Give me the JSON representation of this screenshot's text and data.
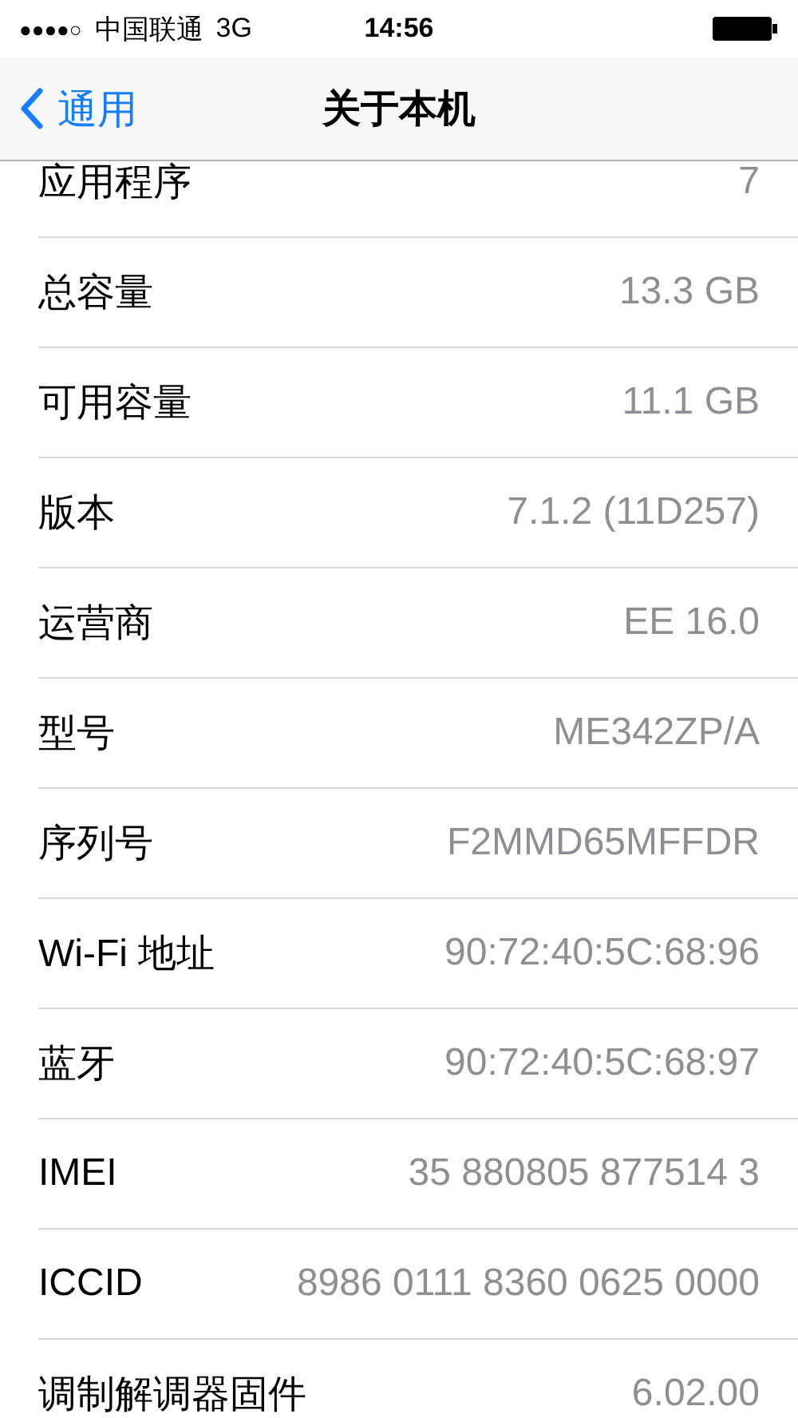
{
  "status_bar": {
    "signal": "●●●●○",
    "carrier": "中国联通",
    "network": "3G",
    "time": "14:56"
  },
  "nav": {
    "back": "通用",
    "title": "关于本机"
  },
  "rows": [
    {
      "label": "应用程序",
      "value": "7"
    },
    {
      "label": "总容量",
      "value": "13.3 GB"
    },
    {
      "label": "可用容量",
      "value": "11.1 GB"
    },
    {
      "label": "版本",
      "value": "7.1.2 (11D257)"
    },
    {
      "label": "运营商",
      "value": "EE 16.0"
    },
    {
      "label": "型号",
      "value": "ME342ZP/A"
    },
    {
      "label": "序列号",
      "value": "F2MMD65MFFDR"
    },
    {
      "label": "Wi-Fi 地址",
      "value": "90:72:40:5C:68:96"
    },
    {
      "label": "蓝牙",
      "value": "90:72:40:5C:68:97"
    },
    {
      "label": "IMEI",
      "value": "35 880805 877514 3"
    },
    {
      "label": "ICCID",
      "value": "8986 0111 8360 0625 0000"
    },
    {
      "label": "调制解调器固件",
      "value": "6.02.00"
    }
  ]
}
